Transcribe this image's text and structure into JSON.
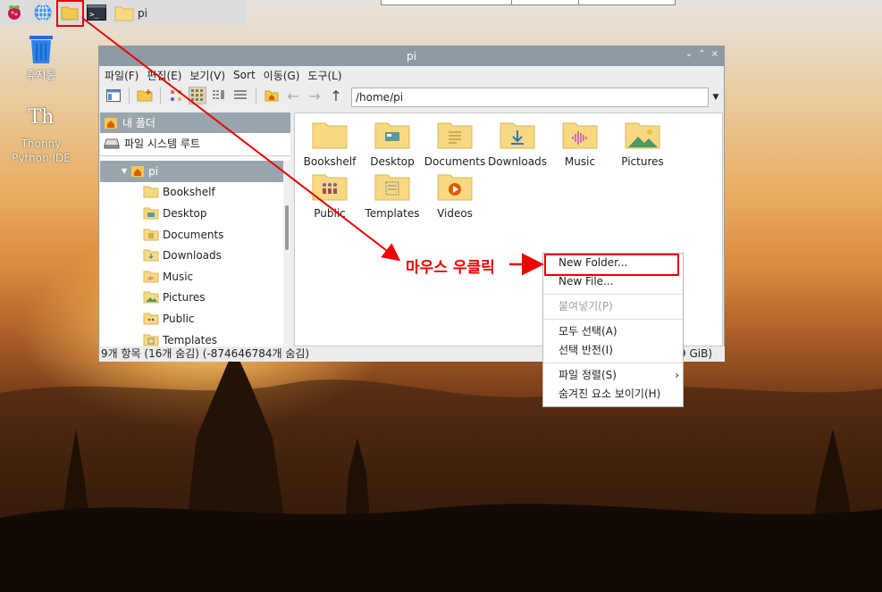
{
  "taskbar": {
    "icons": [
      "raspberry-icon",
      "web-browser-icon",
      "file-manager-icon",
      "terminal-icon"
    ],
    "task_label": "pi"
  },
  "desktop": {
    "trash_label": "휴지통",
    "thonny_label": "Thonny Python IDE",
    "thonny_glyph": "Th"
  },
  "window": {
    "title": "pi",
    "controls": [
      "⌄",
      "⌃",
      "×"
    ],
    "menu": [
      "파일(F)",
      "편집(E)",
      "보기(V)",
      "Sort",
      "이동(G)",
      "도구(L)"
    ],
    "path": "/home/pi",
    "side_places": [
      {
        "label": "내 폴더",
        "icon": "home-icon"
      },
      {
        "label": "파일 시스템 루트",
        "icon": "drive-icon"
      }
    ],
    "tree_root": "pi",
    "tree": [
      {
        "label": "Bookshelf",
        "icon": "folder-icon"
      },
      {
        "label": "Desktop",
        "icon": "desktop-folder-icon"
      },
      {
        "label": "Documents",
        "icon": "documents-folder-icon"
      },
      {
        "label": "Downloads",
        "icon": "downloads-folder-icon"
      },
      {
        "label": "Music",
        "icon": "music-folder-icon"
      },
      {
        "label": "Pictures",
        "icon": "pictures-folder-icon"
      },
      {
        "label": "Public",
        "icon": "public-folder-icon"
      },
      {
        "label": "Templates",
        "icon": "templates-folder-icon"
      }
    ],
    "files": [
      {
        "label": "Bookshelf",
        "icon": "folder-icon"
      },
      {
        "label": "Desktop",
        "icon": "desktop-folder-icon"
      },
      {
        "label": "Documents",
        "icon": "documents-folder-icon"
      },
      {
        "label": "Downloads",
        "icon": "downloads-folder-icon"
      },
      {
        "label": "Music",
        "icon": "music-folder-icon"
      },
      {
        "label": "Pictures",
        "icon": "pictures-folder-icon"
      },
      {
        "label": "Public",
        "icon": "public-folder-icon"
      },
      {
        "label": "Templates",
        "icon": "templates-folder-icon"
      },
      {
        "label": "Videos",
        "icon": "videos-folder-icon"
      }
    ],
    "status_left": "9개 항목 (16개 숨김) (-874646784개 숨김)",
    "status_right": "9 GiB)"
  },
  "context_menu": {
    "new_folder": "New Folder...",
    "new_file": "New File...",
    "paste": "붙여넣기(P)",
    "select_all": "모두 선택(A)",
    "invert_selection": "선택 반전(I)",
    "sort_files": "파일 정렬(S)",
    "show_hidden": "숨겨진 요소 보이기(H)",
    "submenu_arrow": "›"
  },
  "annotation": {
    "text": "마우스 우클릭",
    "color": "#e00000"
  },
  "colors": {
    "titlebar": "#8e9aa3",
    "selection": "#9aa6ae",
    "folder": "#f7d982",
    "highlight": "#e00000"
  }
}
